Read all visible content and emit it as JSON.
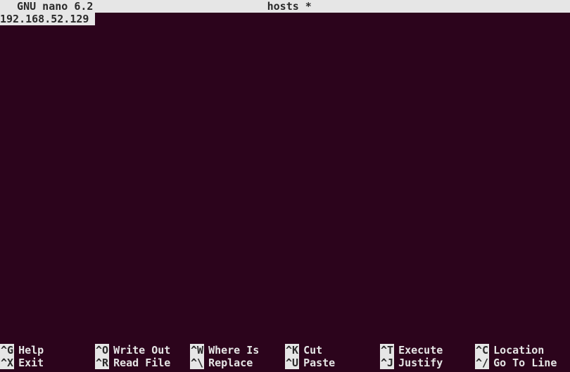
{
  "titlebar": {
    "app": "  GNU nano 6.2",
    "filename": "hosts *"
  },
  "editor": {
    "line1": "192.168.52.129"
  },
  "shortcuts": [
    {
      "key": "^G",
      "label": "Help"
    },
    {
      "key": "^O",
      "label": "Write Out"
    },
    {
      "key": "^W",
      "label": "Where Is"
    },
    {
      "key": "^K",
      "label": "Cut"
    },
    {
      "key": "^T",
      "label": "Execute"
    },
    {
      "key": "^C",
      "label": "Location"
    },
    {
      "key": "^X",
      "label": "Exit"
    },
    {
      "key": "^R",
      "label": "Read File"
    },
    {
      "key": "^\\",
      "label": "Replace"
    },
    {
      "key": "^U",
      "label": "Paste"
    },
    {
      "key": "^J",
      "label": "Justify"
    },
    {
      "key": "^/",
      "label": "Go To Line"
    }
  ]
}
